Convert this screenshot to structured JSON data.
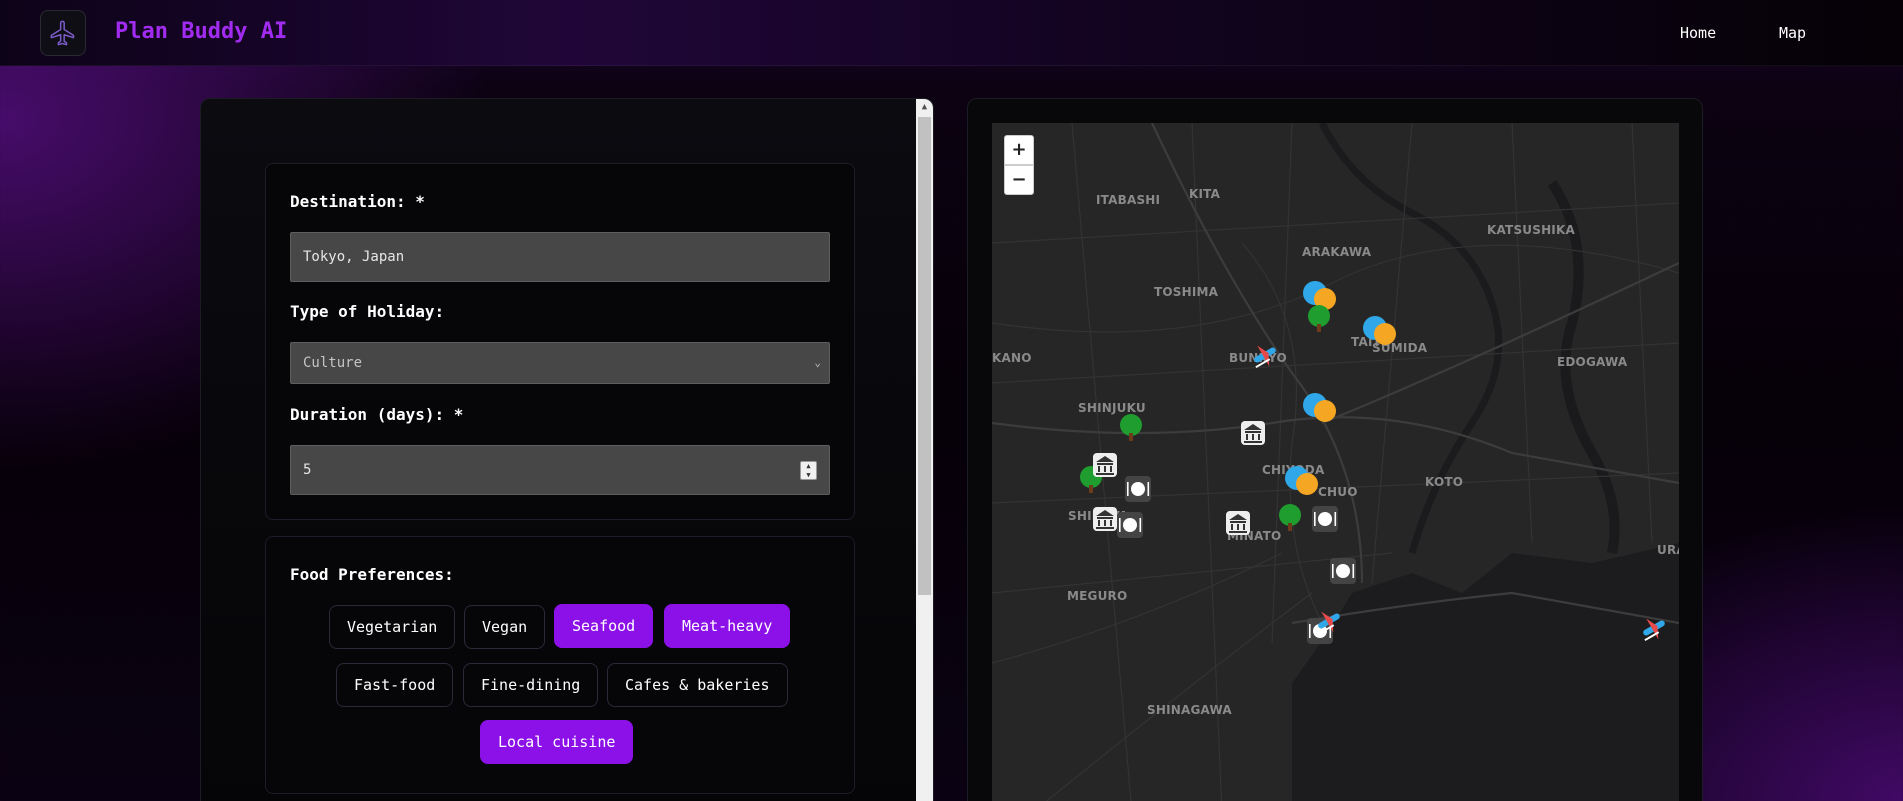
{
  "header": {
    "brand": "Plan Buddy AI",
    "nav": [
      "Home",
      "Map"
    ]
  },
  "form": {
    "destination_label": "Destination: *",
    "destination_value": "Tokyo, Japan",
    "holiday_label": "Type of Holiday:",
    "holiday_value": "Culture",
    "duration_label": "Duration (days): *",
    "duration_value": "5",
    "food_label": "Food Preferences:",
    "food_options": [
      {
        "label": "Vegetarian",
        "selected": false
      },
      {
        "label": "Vegan",
        "selected": false
      },
      {
        "label": "Seafood",
        "selected": true
      },
      {
        "label": "Meat-heavy",
        "selected": true
      },
      {
        "label": "Fast-food",
        "selected": false
      },
      {
        "label": "Fine-dining",
        "selected": false
      },
      {
        "label": "Cafes & bakeries",
        "selected": false
      },
      {
        "label": "Local cuisine",
        "selected": true
      }
    ]
  },
  "map": {
    "zoom_in": "+",
    "zoom_out": "−",
    "places": [
      "ITABASHI",
      "KITA",
      "KATSUSHIKA",
      "ARAKAWA",
      "TOSHIMA",
      "KANO",
      "BUNKYO",
      "TAITO",
      "SUMIDA",
      "EDOGAWA",
      "SHINJUKU",
      "CHIYODA",
      "KOTO",
      "SHIBUYA",
      "MINATO",
      "CHUO",
      "URAYASU",
      "MEGURO",
      "SHINAGAWA"
    ],
    "marker_icons": [
      "theater-masks-icon",
      "tree-icon",
      "museum-icon",
      "restaurant-icon",
      "plane-icon"
    ],
    "accent_color": "#8c10e8"
  }
}
